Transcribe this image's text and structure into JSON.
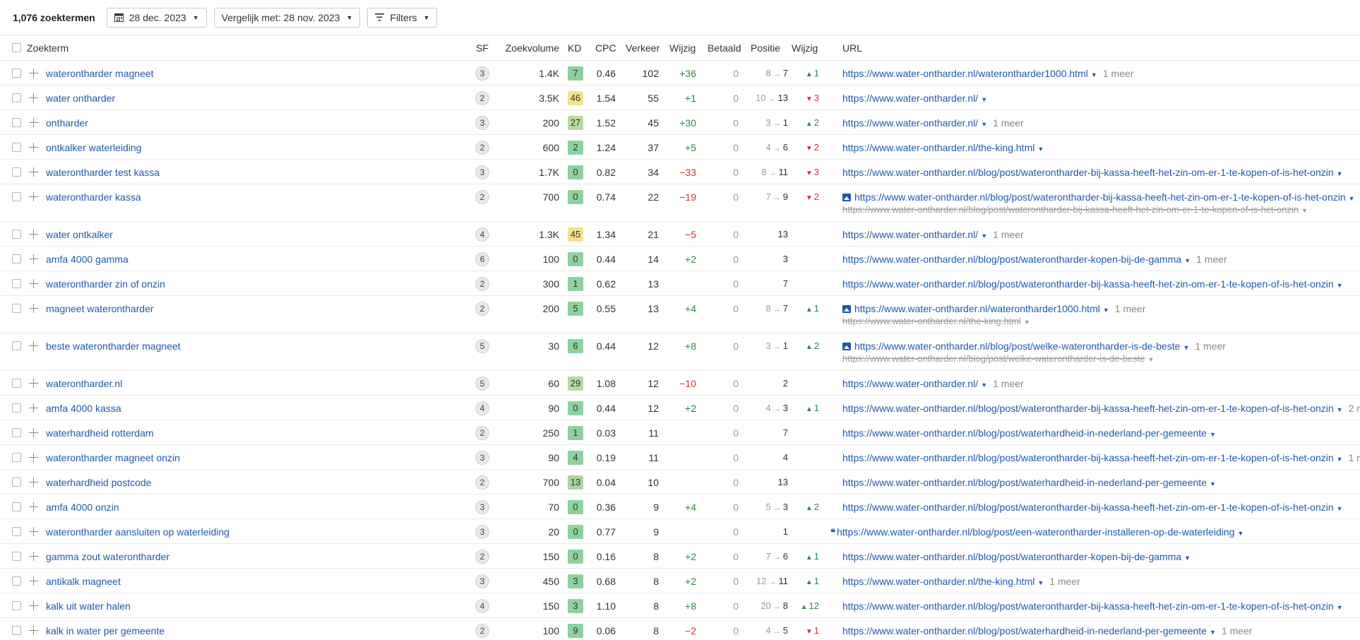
{
  "toolbar": {
    "count": "1,076 zoektermen",
    "date": "28 dec. 2023",
    "compare": "Vergelijk met: 28 nov. 2023",
    "filters": "Filters"
  },
  "columns": {
    "keyword": "Zoekterm",
    "sf": "SF",
    "volume": "Zoekvolume",
    "kd": "KD",
    "cpc": "CPC",
    "traffic": "Verkeer",
    "traffic_change": "Wijzig",
    "paid": "Betaald",
    "position": "Positie",
    "position_change": "Wijzig",
    "url": "URL"
  },
  "colors": {
    "kd_easy": "#8fd19e",
    "kd_light": "#b8dba0",
    "kd_medium": "#f5e08a",
    "up": "#2a8a3e",
    "down": "#d0312d",
    "link": "#1e5aa8"
  },
  "rows": [
    {
      "kw": "waterontharder magneet",
      "sf": "3",
      "vol": "1.4K",
      "kd": "7",
      "kdc": "#8fd19e",
      "cpc": "0.46",
      "traffic": "102",
      "tch": "+36",
      "paid": "0",
      "pfrom": "8",
      "pto": "7",
      "pch": "1",
      "pdir": "up",
      "url": "https://www.water-ontharder.nl/waterontharder1000.html",
      "more": "1 meer"
    },
    {
      "kw": "water ontharder",
      "sf": "2",
      "vol": "3.5K",
      "kd": "46",
      "kdc": "#f5e08a",
      "cpc": "1.54",
      "traffic": "55",
      "tch": "+1",
      "paid": "0",
      "pfrom": "10",
      "pto": "13",
      "pch": "3",
      "pdir": "down",
      "url": "https://www.water-ontharder.nl/",
      "more": ""
    },
    {
      "kw": "ontharder",
      "sf": "3",
      "vol": "200",
      "kd": "27",
      "kdc": "#b8dba0",
      "cpc": "1.52",
      "traffic": "45",
      "tch": "+30",
      "paid": "0",
      "pfrom": "3",
      "pto": "1",
      "pch": "2",
      "pdir": "up",
      "url": "https://www.water-ontharder.nl/",
      "more": "1 meer"
    },
    {
      "kw": "ontkalker waterleiding",
      "sf": "2",
      "vol": "600",
      "kd": "2",
      "kdc": "#8fd19e",
      "cpc": "1.24",
      "traffic": "37",
      "tch": "+5",
      "paid": "0",
      "pfrom": "4",
      "pto": "6",
      "pch": "2",
      "pdir": "down",
      "url": "https://www.water-ontharder.nl/the-king.html",
      "more": ""
    },
    {
      "kw": "waterontharder test kassa",
      "sf": "3",
      "vol": "1.7K",
      "kd": "0",
      "kdc": "#8fd19e",
      "cpc": "0.82",
      "traffic": "34",
      "tch": "−33",
      "paid": "0",
      "pfrom": "8",
      "pto": "11",
      "pch": "3",
      "pdir": "down",
      "url": "https://www.water-ontharder.nl/blog/post/waterontharder-bij-kassa-heeft-het-zin-om-er-1-te-kopen-of-is-het-onzin",
      "more": ""
    },
    {
      "kw": "waterontharder kassa",
      "sf": "2",
      "vol": "700",
      "kd": "0",
      "kdc": "#8fd19e",
      "cpc": "0.74",
      "traffic": "22",
      "tch": "−19",
      "paid": "0",
      "pfrom": "7",
      "pto": "9",
      "pch": "2",
      "pdir": "down",
      "icon": "img",
      "url": "https://www.water-ontharder.nl/blog/post/waterontharder-bij-kassa-heeft-het-zin-om-er-1-te-kopen-of-is-het-onzin",
      "more": "",
      "url2": "https://www.water-ontharder.nl/blog/post/waterontharder-bij-kassa-heeft-het-zin-om-er-1-te-kopen-of-is-het-onzin"
    },
    {
      "kw": "water ontkalker",
      "sf": "4",
      "vol": "1.3K",
      "kd": "45",
      "kdc": "#f5e08a",
      "cpc": "1.34",
      "traffic": "21",
      "tch": "−5",
      "paid": "0",
      "pfrom": "",
      "pto": "13",
      "pch": "",
      "pdir": "",
      "url": "https://www.water-ontharder.nl/",
      "more": "1 meer"
    },
    {
      "kw": "amfa 4000 gamma",
      "sf": "6",
      "vol": "100",
      "kd": "0",
      "kdc": "#8fd19e",
      "cpc": "0.44",
      "traffic": "14",
      "tch": "+2",
      "paid": "0",
      "pfrom": "",
      "pto": "3",
      "pch": "",
      "pdir": "",
      "url": "https://www.water-ontharder.nl/blog/post/waterontharder-kopen-bij-de-gamma",
      "more": "1 meer"
    },
    {
      "kw": "waterontharder zin of onzin",
      "sf": "2",
      "vol": "300",
      "kd": "1",
      "kdc": "#8fd19e",
      "cpc": "0.62",
      "traffic": "13",
      "tch": "",
      "paid": "0",
      "pfrom": "",
      "pto": "7",
      "pch": "",
      "pdir": "",
      "url": "https://www.water-ontharder.nl/blog/post/waterontharder-bij-kassa-heeft-het-zin-om-er-1-te-kopen-of-is-het-onzin",
      "more": ""
    },
    {
      "kw": "magneet waterontharder",
      "sf": "2",
      "vol": "200",
      "kd": "5",
      "kdc": "#8fd19e",
      "cpc": "0.55",
      "traffic": "13",
      "tch": "+4",
      "paid": "0",
      "pfrom": "8",
      "pto": "7",
      "pch": "1",
      "pdir": "up",
      "icon": "img",
      "url": "https://www.water-ontharder.nl/waterontharder1000.html",
      "more": "1 meer",
      "url2": "https://www.water-ontharder.nl/the-king.html"
    },
    {
      "kw": "beste waterontharder magneet",
      "sf": "5",
      "vol": "30",
      "kd": "6",
      "kdc": "#8fd19e",
      "cpc": "0.44",
      "traffic": "12",
      "tch": "+8",
      "paid": "0",
      "pfrom": "3",
      "pto": "1",
      "pch": "2",
      "pdir": "up",
      "icon": "img",
      "url": "https://www.water-ontharder.nl/blog/post/welke-waterontharder-is-de-beste",
      "more": "1 meer",
      "url2": "https://www.water-ontharder.nl/blog/post/welke-waterontharder-is-de-beste"
    },
    {
      "kw": "waterontharder.nl",
      "sf": "5",
      "vol": "60",
      "kd": "29",
      "kdc": "#b8dba0",
      "cpc": "1.08",
      "traffic": "12",
      "tch": "−10",
      "paid": "0",
      "pfrom": "",
      "pto": "2",
      "pch": "",
      "pdir": "",
      "url": "https://www.water-ontharder.nl/",
      "more": "1 meer"
    },
    {
      "kw": "amfa 4000 kassa",
      "sf": "4",
      "vol": "90",
      "kd": "0",
      "kdc": "#8fd19e",
      "cpc": "0.44",
      "traffic": "12",
      "tch": "+2",
      "paid": "0",
      "pfrom": "4",
      "pto": "3",
      "pch": "1",
      "pdir": "up",
      "url": "https://www.water-ontharder.nl/blog/post/waterontharder-bij-kassa-heeft-het-zin-om-er-1-te-kopen-of-is-het-onzin",
      "more": "2 m"
    },
    {
      "kw": "waterhardheid rotterdam",
      "sf": "2",
      "vol": "250",
      "kd": "1",
      "kdc": "#8fd19e",
      "cpc": "0.03",
      "traffic": "11",
      "tch": "",
      "paid": "0",
      "pfrom": "",
      "pto": "7",
      "pch": "",
      "pdir": "",
      "url": "https://www.water-ontharder.nl/blog/post/waterhardheid-in-nederland-per-gemeente",
      "more": ""
    },
    {
      "kw": "waterontharder magneet onzin",
      "sf": "3",
      "vol": "90",
      "kd": "4",
      "kdc": "#8fd19e",
      "cpc": "0.19",
      "traffic": "11",
      "tch": "",
      "paid": "0",
      "pfrom": "",
      "pto": "4",
      "pch": "",
      "pdir": "",
      "url": "https://www.water-ontharder.nl/blog/post/waterontharder-bij-kassa-heeft-het-zin-om-er-1-te-kopen-of-is-het-onzin",
      "more": "1 m"
    },
    {
      "kw": "waterhardheid postcode",
      "sf": "2",
      "vol": "700",
      "kd": "13",
      "kdc": "#a9d6a0",
      "cpc": "0.04",
      "traffic": "10",
      "tch": "",
      "paid": "0",
      "pfrom": "",
      "pto": "13",
      "pch": "",
      "pdir": "",
      "url": "https://www.water-ontharder.nl/blog/post/waterhardheid-in-nederland-per-gemeente",
      "more": ""
    },
    {
      "kw": "amfa 4000 onzin",
      "sf": "3",
      "vol": "70",
      "kd": "0",
      "kdc": "#8fd19e",
      "cpc": "0.36",
      "traffic": "9",
      "tch": "+4",
      "paid": "0",
      "pfrom": "5",
      "pto": "3",
      "pch": "2",
      "pdir": "up",
      "url": "https://www.water-ontharder.nl/blog/post/waterontharder-bij-kassa-heeft-het-zin-om-er-1-te-kopen-of-is-het-onzin",
      "more": ""
    },
    {
      "kw": "waterontharder aansluiten op waterleiding",
      "sf": "3",
      "vol": "20",
      "kd": "0",
      "kdc": "#8fd19e",
      "cpc": "0.77",
      "traffic": "9",
      "tch": "",
      "paid": "0",
      "pfrom": "",
      "pto": "1",
      "pch": "",
      "pdir": "",
      "icon": "quote",
      "url": "https://www.water-ontharder.nl/blog/post/een-waterontharder-installeren-op-de-waterleiding",
      "more": ""
    },
    {
      "kw": "gamma zout waterontharder",
      "sf": "2",
      "vol": "150",
      "kd": "0",
      "kdc": "#8fd19e",
      "cpc": "0.16",
      "traffic": "8",
      "tch": "+2",
      "paid": "0",
      "pfrom": "7",
      "pto": "6",
      "pch": "1",
      "pdir": "up",
      "url": "https://www.water-ontharder.nl/blog/post/waterontharder-kopen-bij-de-gamma",
      "more": ""
    },
    {
      "kw": "antikalk magneet",
      "sf": "3",
      "vol": "450",
      "kd": "3",
      "kdc": "#8fd19e",
      "cpc": "0.68",
      "traffic": "8",
      "tch": "+2",
      "paid": "0",
      "pfrom": "12",
      "pto": "11",
      "pch": "1",
      "pdir": "up",
      "url": "https://www.water-ontharder.nl/the-king.html",
      "more": "1 meer"
    },
    {
      "kw": "kalk uit water halen",
      "sf": "4",
      "vol": "150",
      "kd": "3",
      "kdc": "#8fd19e",
      "cpc": "1.10",
      "traffic": "8",
      "tch": "+8",
      "paid": "0",
      "pfrom": "20",
      "pto": "8",
      "pch": "12",
      "pdir": "up",
      "url": "https://www.water-ontharder.nl/blog/post/waterontharder-bij-kassa-heeft-het-zin-om-er-1-te-kopen-of-is-het-onzin",
      "more": ""
    },
    {
      "kw": "kalk in water per gemeente",
      "sf": "2",
      "vol": "100",
      "kd": "9",
      "kdc": "#8fd19e",
      "cpc": "0.06",
      "traffic": "8",
      "tch": "−2",
      "paid": "0",
      "pfrom": "4",
      "pto": "5",
      "pch": "1",
      "pdir": "down",
      "url": "https://www.water-ontharder.nl/blog/post/waterhardheid-in-nederland-per-gemeente",
      "more": "1 meer"
    }
  ]
}
